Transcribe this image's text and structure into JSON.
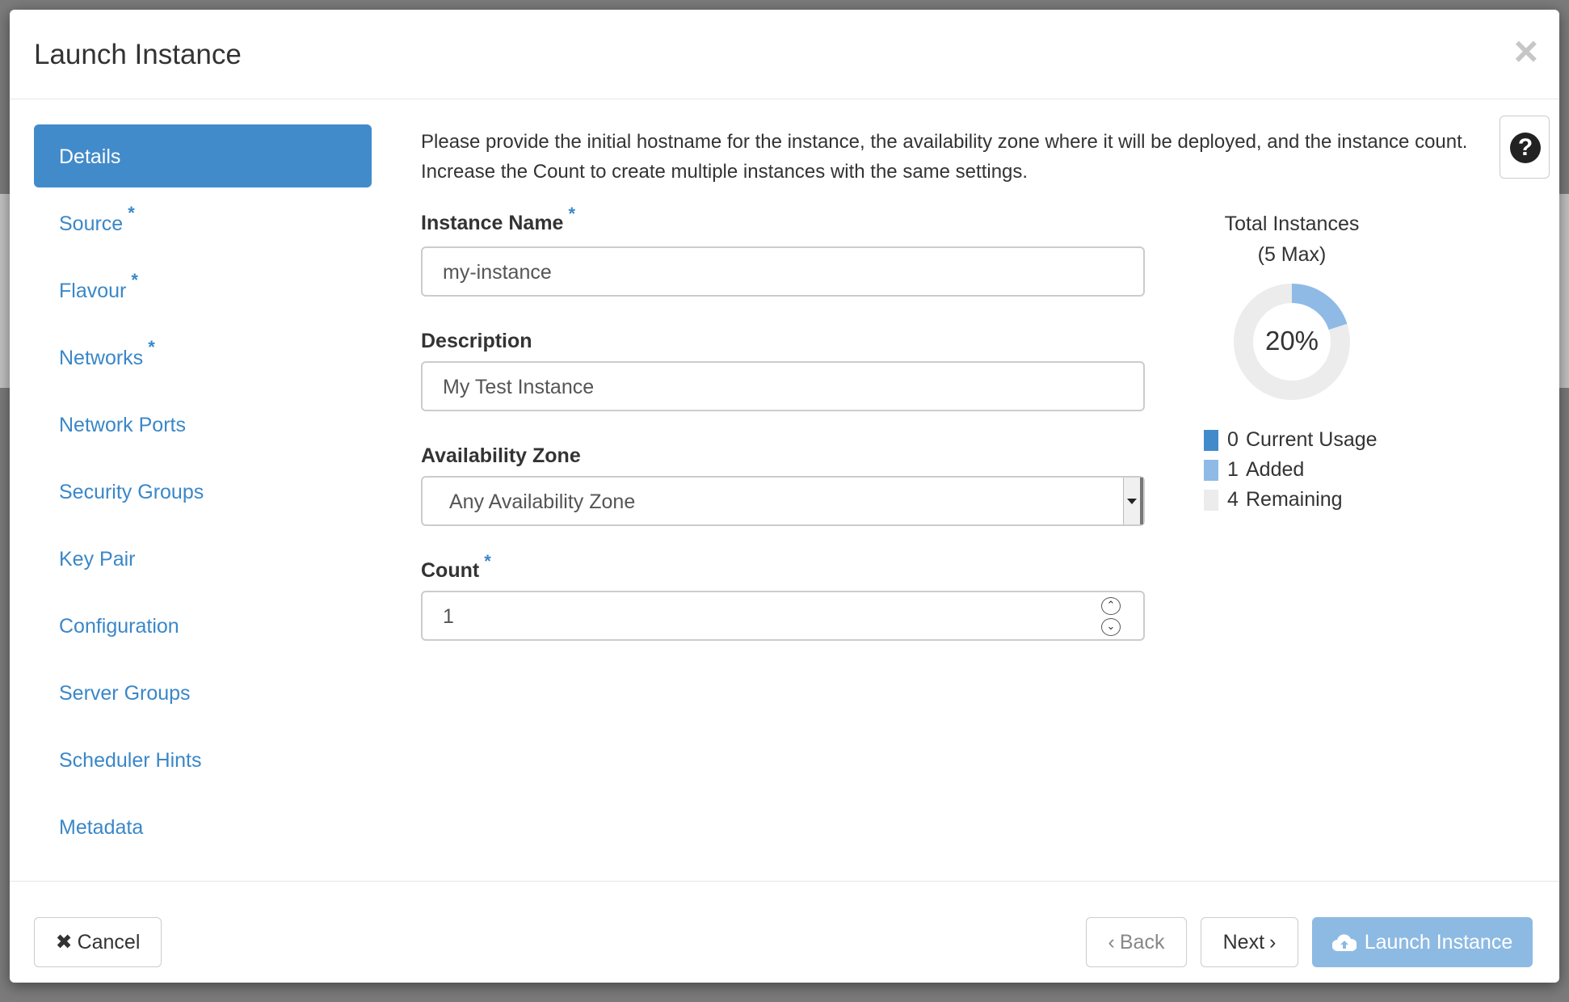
{
  "modal": {
    "title": "Launch Instance",
    "close_glyph": "×",
    "help_glyph": "?"
  },
  "nav": [
    {
      "label": "Details",
      "required": false,
      "active": true
    },
    {
      "label": "Source",
      "required": true
    },
    {
      "label": "Flavour",
      "required": true
    },
    {
      "label": "Networks",
      "required": true
    },
    {
      "label": "Network Ports",
      "required": false
    },
    {
      "label": "Security Groups",
      "required": false
    },
    {
      "label": "Key Pair",
      "required": false
    },
    {
      "label": "Configuration",
      "required": false
    },
    {
      "label": "Server Groups",
      "required": false
    },
    {
      "label": "Scheduler Hints",
      "required": false
    },
    {
      "label": "Metadata",
      "required": false
    }
  ],
  "required_marker": "*",
  "details": {
    "intro": "Please provide the initial hostname for the instance, the availability zone where it will be deployed, and the instance count. Increase the Count to create multiple instances with the same settings.",
    "instance_name": {
      "label": "Instance Name",
      "value": "my-instance"
    },
    "description": {
      "label": "Description",
      "value": "My Test Instance"
    },
    "availability_zone": {
      "label": "Availability Zone",
      "value": "Any Availability Zone"
    },
    "count": {
      "label": "Count",
      "value": "1"
    }
  },
  "chart_data": {
    "type": "pie",
    "title": "Total Instances",
    "subtitle": "(5 Max)",
    "center_label": "20%",
    "max": 5,
    "series": [
      {
        "name": "Current Usage",
        "value": 0,
        "color": "#428bca"
      },
      {
        "name": "Added",
        "value": 1,
        "color": "#8fbae6"
      },
      {
        "name": "Remaining",
        "value": 4,
        "color": "#ececec"
      }
    ]
  },
  "legend": [
    {
      "count": "0",
      "label": "Current Usage",
      "color": "#428bca"
    },
    {
      "count": "1",
      "label": "Added",
      "color": "#8fbae6"
    },
    {
      "count": "4",
      "label": "Remaining",
      "color": "#ececec"
    }
  ],
  "footer": {
    "cancel": "Cancel",
    "back": "Back",
    "next": "Next",
    "launch": "Launch Instance"
  },
  "colors": {
    "accent": "#428bca",
    "launch_disabled": "#8dbae3"
  }
}
